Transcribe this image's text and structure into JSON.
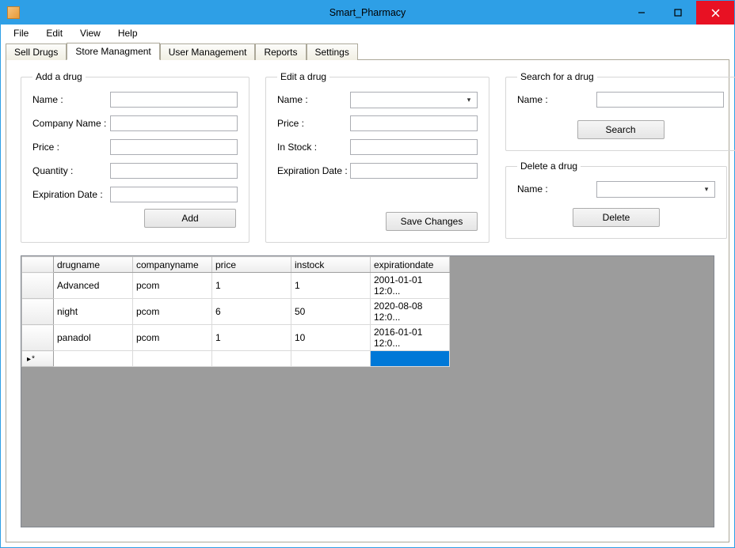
{
  "window": {
    "title": "Smart_Pharmacy"
  },
  "menubar": {
    "items": [
      "File",
      "Edit",
      "View",
      "Help"
    ]
  },
  "tabs": {
    "items": [
      "Sell Drugs",
      "Store Managment",
      "User Management",
      "Reports",
      "Settings"
    ]
  },
  "groups": {
    "add": {
      "legend": "Add a drug",
      "name_label": "Name :",
      "company_label": "Company Name :",
      "price_label": "Price :",
      "quantity_label": "Quantity :",
      "expiration_label": "Expiration Date :",
      "button": "Add"
    },
    "edit": {
      "legend": "Edit a drug",
      "name_label": "Name :",
      "price_label": "Price :",
      "instock_label": "In Stock :",
      "expiration_label": "Expiration Date :",
      "button": "Save Changes"
    },
    "search": {
      "legend": "Search for a drug",
      "name_label": "Name :",
      "button": "Search"
    },
    "delete": {
      "legend": "Delete a drug",
      "name_label": "Name :",
      "button": "Delete"
    }
  },
  "grid": {
    "headers": {
      "drugname": "drugname",
      "companyname": "companyname",
      "price": "price",
      "instock": "instock",
      "expirationdate": "expirationdate"
    },
    "rows": [
      {
        "drugname": "Advanced",
        "companyname": "pcom",
        "price": "1",
        "instock": "1",
        "expirationdate": "2001-01-01 12:0..."
      },
      {
        "drugname": "night",
        "companyname": "pcom",
        "price": "6",
        "instock": "50",
        "expirationdate": "2020-08-08 12:0..."
      },
      {
        "drugname": "panadol",
        "companyname": "pcom",
        "price": "1",
        "instock": "10",
        "expirationdate": "2016-01-01 12:0..."
      }
    ],
    "newrow_marker": "▸*"
  }
}
